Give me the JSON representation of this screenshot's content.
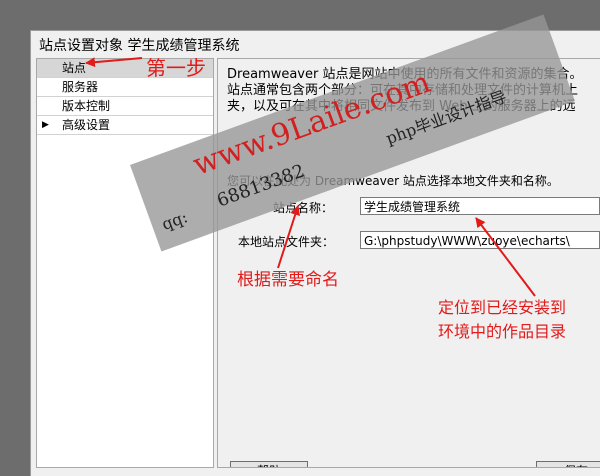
{
  "dialog": {
    "title": "站点设置对象 学生成绩管理系统"
  },
  "sidebar": {
    "items": [
      {
        "label": "站点",
        "selected": true
      },
      {
        "label": "服务器"
      },
      {
        "label": "版本控制"
      },
      {
        "label": "高级设置",
        "expandable": true
      }
    ]
  },
  "panel": {
    "desc_line1": "Dreamweaver 站点是网站中使用的所有文件和资源的集合。",
    "desc_line2": "站点通常包含两个部分：可在其中存储和处理文件的计算机上",
    "desc_line3": "夹，以及可在其中将相同文件发布到 Web 上的服务器上的远",
    "prompt": "您可以在此处为 Dreamweaver 站点选择本地文件夹和名称。",
    "site_name_label": "站点名称：",
    "site_name_value": "学生成绩管理系统",
    "local_folder_label": "本地站点文件夹：",
    "local_folder_value": "G:\\phpstudy\\WWW\\zuoye\\echarts\\",
    "help_button": "帮助",
    "save_button": "保存"
  },
  "annotations": {
    "step_one": "第一步",
    "name_hint": "根据需要命名",
    "folder_hint_line1": "定位到已经安装到",
    "folder_hint_line2": "环境中的作品目录",
    "color": "#e21a1a"
  },
  "watermark": {
    "site": "www.9Laile.com",
    "tagline": "php毕业设计指导",
    "qq_label": "qq:",
    "qq_number": "68813382"
  }
}
